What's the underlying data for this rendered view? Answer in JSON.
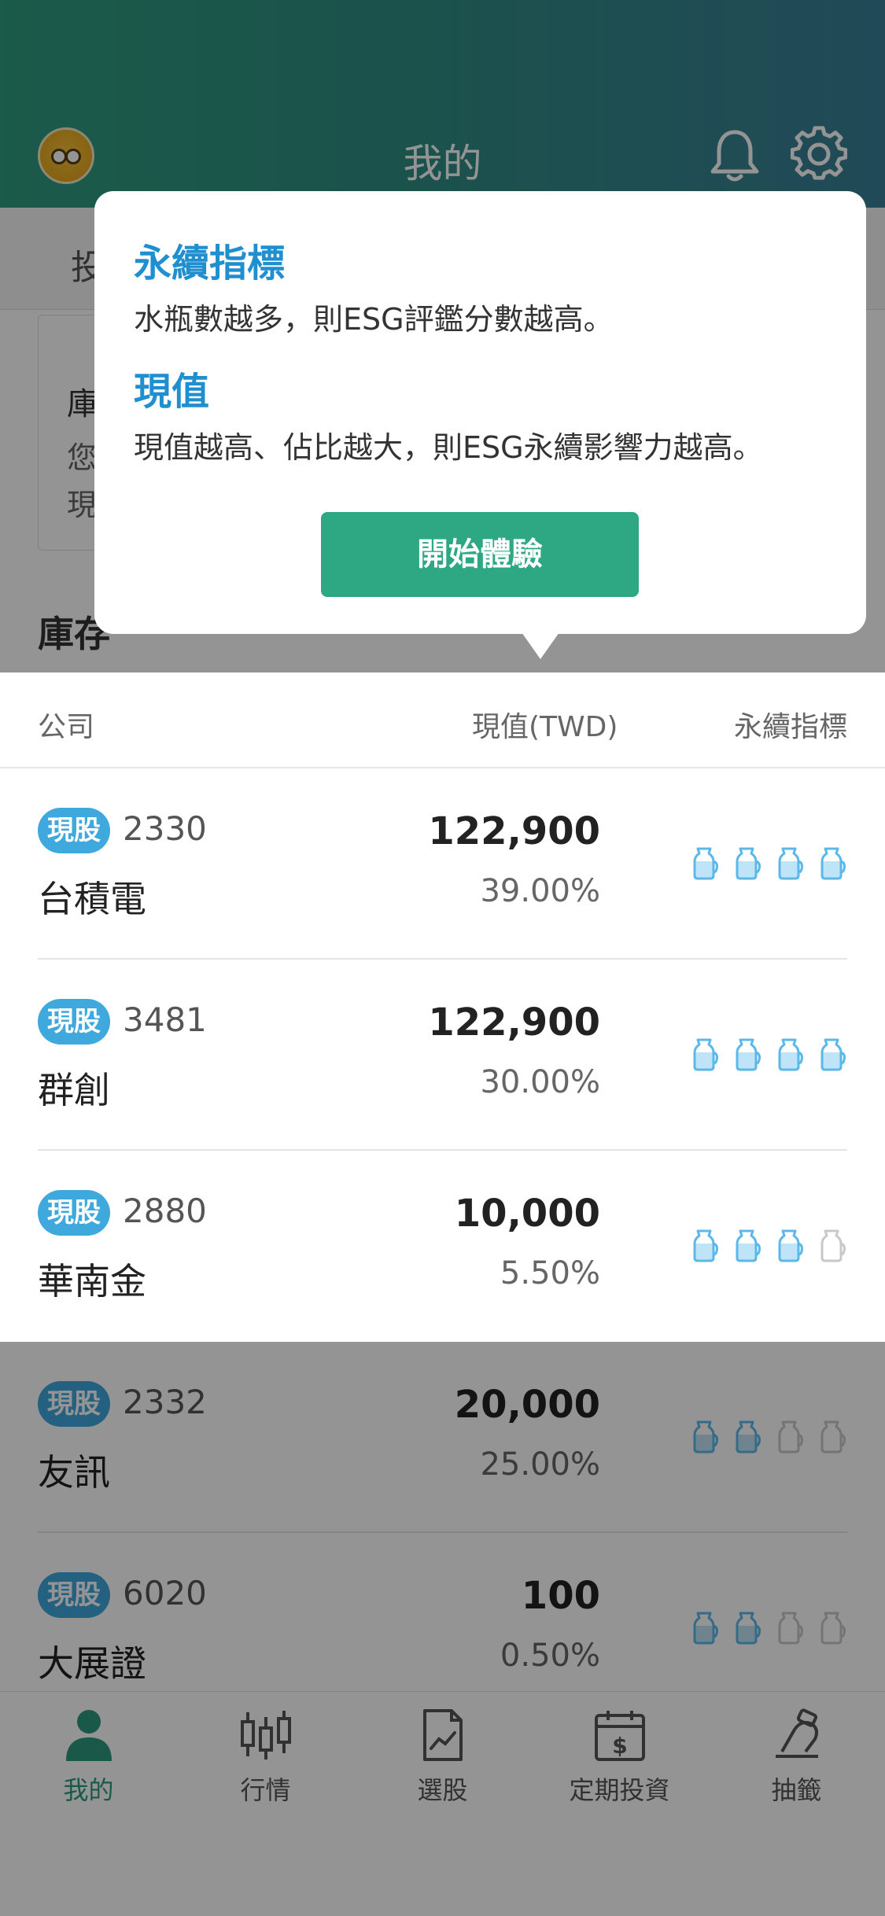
{
  "header": {
    "title": "我的"
  },
  "background": {
    "tab_label": "投",
    "notice_title": "庫",
    "notice_line1": "您",
    "notice_line2": "現",
    "section_title": "庫存"
  },
  "table": {
    "columns": [
      "公司",
      "現值(TWD)",
      "永續指標"
    ],
    "rows": [
      {
        "badge": "現股",
        "code": "2330",
        "name": "台積電",
        "value": "122,900",
        "percent": "39.00%",
        "bottles_filled": 4
      },
      {
        "badge": "現股",
        "code": "3481",
        "name": "群創",
        "value": "122,900",
        "percent": "30.00%",
        "bottles_filled": 4
      },
      {
        "badge": "現股",
        "code": "2880",
        "name": "華南金",
        "value": "10,000",
        "percent": "5.50%",
        "bottles_filled": 3
      },
      {
        "badge": "現股",
        "code": "2332",
        "name": "友訊",
        "value": "20,000",
        "percent": "25.00%",
        "bottles_filled": 2
      },
      {
        "badge": "現股",
        "code": "6020",
        "name": "大展證",
        "value": "100",
        "percent": "0.50%",
        "bottles_filled": 2
      }
    ],
    "bottles_total": 4
  },
  "tooltip": {
    "heading1": "永續指標",
    "text1": "水瓶數越多，則ESG評鑑分數越高。",
    "heading2": "現值",
    "text2": "現值越高、佔比越大，則ESG永續影響力越高。",
    "button": "開始體驗"
  },
  "nav": {
    "items": [
      {
        "label": "我的",
        "icon": "person-icon",
        "active": true
      },
      {
        "label": "行情",
        "icon": "candlestick-icon",
        "active": false
      },
      {
        "label": "選股",
        "icon": "document-chart-icon",
        "active": false
      },
      {
        "label": "定期投資",
        "icon": "calendar-dollar-icon",
        "active": false
      },
      {
        "label": "抽籤",
        "icon": "lottery-icon",
        "active": false
      }
    ]
  },
  "colors": {
    "accent_green": "#2ea883",
    "heading_blue": "#1f8fd0",
    "badge_blue": "#3fa8dc",
    "bottle_blue": "#5bb8e8"
  }
}
